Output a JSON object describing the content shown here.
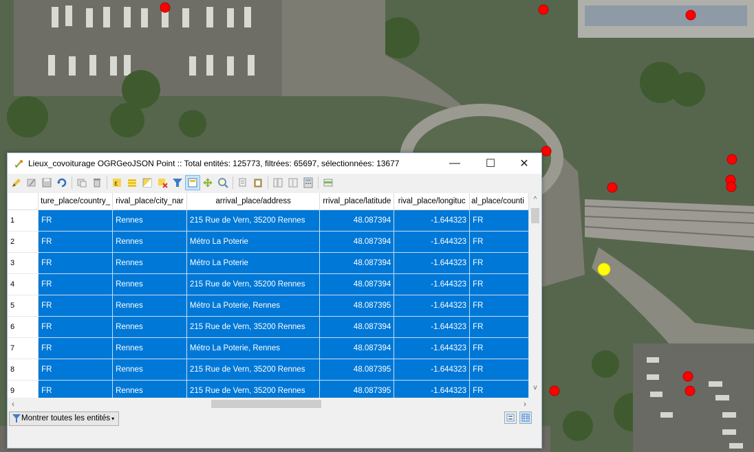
{
  "window": {
    "title": "Lieux_covoiturage OGRGeoJSON Point :: Total entités: 125773, filtrées: 65697, sélectionnées: 13677",
    "minimize_glyph": "—",
    "maximize_glyph": "☐",
    "close_glyph": "✕"
  },
  "toolbar": {
    "icons": [
      "pencil-icon",
      "multi-edit-icon",
      "save-icon",
      "refresh-icon",
      "copy-feature-icon",
      "delete-icon",
      "expression-select-icon",
      "select-all-icon",
      "invert-selection-icon",
      "deselect-icon",
      "filter-selected-icon",
      "move-to-top-icon",
      "pan-to-selected-icon",
      "zoom-to-selected-icon",
      "copy-icon",
      "paste-icon",
      "new-field-icon",
      "delete-field-icon",
      "field-calculator-icon",
      "conditional-format-icon"
    ]
  },
  "table": {
    "columns": [
      "ture_place/country_",
      "rival_place/city_nar",
      "arrival_place/address",
      "rrival_place/latitude",
      "rival_place/longituc",
      "al_place/counti"
    ],
    "rows": [
      {
        "idx": "1",
        "country": "FR",
        "city": "Rennes",
        "address": "215 Rue de Vern, 35200 Rennes",
        "lat": "48.087394",
        "lon": "-1.644323",
        "acountry": "FR"
      },
      {
        "idx": "2",
        "country": "FR",
        "city": "Rennes",
        "address": "Métro La Poterie",
        "lat": "48.087394",
        "lon": "-1.644323",
        "acountry": "FR"
      },
      {
        "idx": "3",
        "country": "FR",
        "city": "Rennes",
        "address": "Métro La Poterie",
        "lat": "48.087394",
        "lon": "-1.644323",
        "acountry": "FR"
      },
      {
        "idx": "4",
        "country": "FR",
        "city": "Rennes",
        "address": "215 Rue de Vern, 35200 Rennes",
        "lat": "48.087394",
        "lon": "-1.644323",
        "acountry": "FR"
      },
      {
        "idx": "5",
        "country": "FR",
        "city": "Rennes",
        "address": "Métro La Poterie, Rennes",
        "lat": "48.087395",
        "lon": "-1.644323",
        "acountry": "FR"
      },
      {
        "idx": "6",
        "country": "FR",
        "city": "Rennes",
        "address": "215 Rue de Vern, 35200 Rennes",
        "lat": "48.087394",
        "lon": "-1.644323",
        "acountry": "FR"
      },
      {
        "idx": "7",
        "country": "FR",
        "city": "Rennes",
        "address": "Métro La Poterie, Rennes",
        "lat": "48.087394",
        "lon": "-1.644323",
        "acountry": "FR"
      },
      {
        "idx": "8",
        "country": "FR",
        "city": "Rennes",
        "address": "215 Rue de Vern, 35200 Rennes",
        "lat": "48.087395",
        "lon": "-1.644323",
        "acountry": "FR"
      },
      {
        "idx": "9",
        "country": "FR",
        "city": "Rennes",
        "address": "215 Rue de Vern, 35200 Rennes",
        "lat": "48.087395",
        "lon": "-1.644323",
        "acountry": "FR"
      }
    ]
  },
  "bottom": {
    "show_all_label": "Montrer toutes les entités"
  },
  "colors": {
    "selection": "#0078d7",
    "map_point": "#ff0000",
    "highlight_point": "#ffff00"
  }
}
